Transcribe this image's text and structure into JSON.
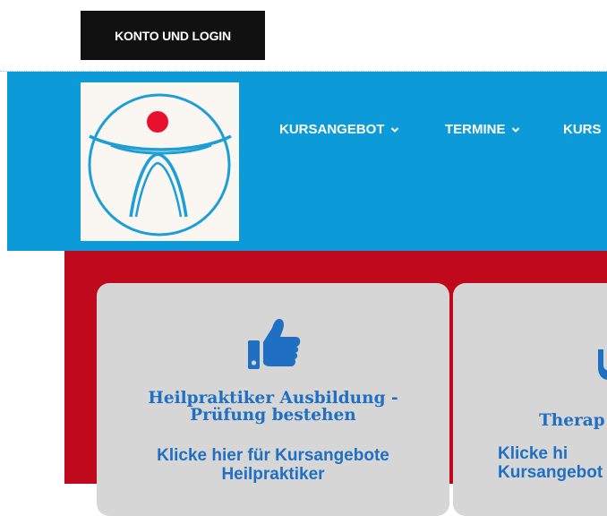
{
  "topbar": {
    "account_label": "KONTO UND LOGIN"
  },
  "nav": {
    "items": [
      {
        "label": "KURSANGEBOT"
      },
      {
        "label": "TERMINE"
      },
      {
        "label": "KURS"
      }
    ]
  },
  "cards": [
    {
      "icon": "thumbs-up-icon",
      "title": "Heilpraktiker Ausbildung - Prüfung bestehen",
      "link": "Klicke hier für Kursangebote Heilpraktiker"
    },
    {
      "icon": "thumbs-up-icon",
      "title": "Therap",
      "link": "Klicke hi Kursangebot"
    }
  ],
  "colors": {
    "header_blue": "#0d9ad8",
    "section_red": "#c0091d",
    "card_grey": "#d6d6d6",
    "accent_blue": "#1f6fc2",
    "logo_red": "#e8112d"
  }
}
